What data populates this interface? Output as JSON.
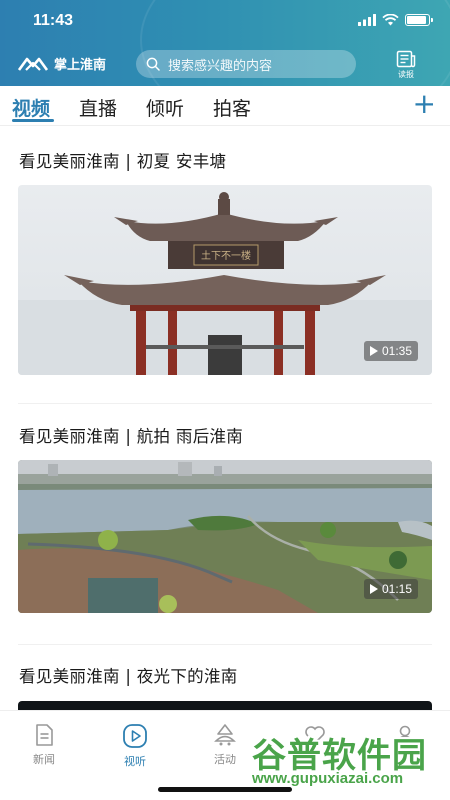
{
  "status_bar": {
    "time": "11:43"
  },
  "app_bar": {
    "logo_text": "掌上淮南",
    "search_placeholder": "搜索感兴趣的内容",
    "read_label": "读报"
  },
  "tabs": [
    {
      "label": "视频",
      "active": true
    },
    {
      "label": "直播",
      "active": false
    },
    {
      "label": "倾听",
      "active": false
    },
    {
      "label": "拍客",
      "active": false
    }
  ],
  "feed": [
    {
      "title": "看见美丽淮南 | 初夏 安丰塘",
      "duration": "01:35"
    },
    {
      "title": "看见美丽淮南 | 航拍 雨后淮南",
      "duration": "01:15"
    },
    {
      "title": "看见美丽淮南 | 夜光下的淮南",
      "duration": ""
    }
  ],
  "pavilion_plaque": "土下不一楼",
  "bottom_nav": [
    {
      "label": "新闻",
      "icon": "news-icon",
      "active": false
    },
    {
      "label": "视听",
      "icon": "play-circle-icon",
      "active": true
    },
    {
      "label": "活动",
      "icon": "activity-icon",
      "active": false
    },
    {
      "label": "",
      "icon": "heart-icon",
      "active": false
    },
    {
      "label": "",
      "icon": "person-icon",
      "active": false
    }
  ],
  "watermark": {
    "main": "谷普软件园",
    "url": "www.gupuxiazai.com"
  },
  "colors": {
    "brand": "#2d7fb1",
    "header_end": "#3ea6b3"
  }
}
